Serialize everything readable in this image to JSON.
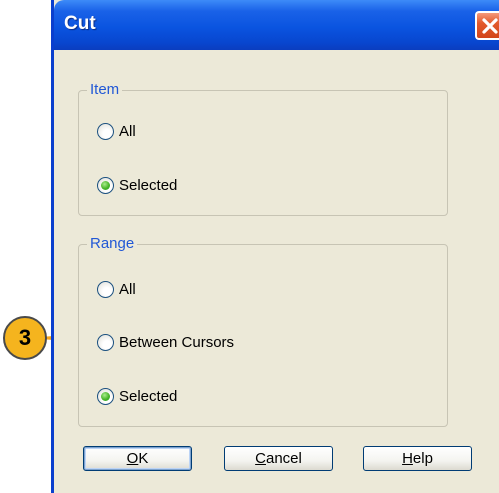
{
  "window": {
    "title": "Cut"
  },
  "item_group": {
    "legend": "Item",
    "options": [
      {
        "label": "All",
        "checked": false
      },
      {
        "label": "Selected",
        "checked": true
      }
    ]
  },
  "range_group": {
    "legend": "Range",
    "options": [
      {
        "label": "All",
        "checked": false
      },
      {
        "label": "Between Cursors",
        "checked": false
      },
      {
        "label": "Selected",
        "checked": true
      }
    ]
  },
  "buttons": {
    "ok": {
      "mnemonic": "O",
      "rest": "K"
    },
    "cancel": {
      "mnemonic": "C",
      "rest": "ancel"
    },
    "help": {
      "mnemonic": "H",
      "rest": "elp"
    }
  },
  "callout": {
    "number": "3",
    "color": "#f5b41e"
  },
  "colors": {
    "titlebar": "#0a54e0",
    "close_button": "#e35a2c",
    "legend_text": "#2158d6",
    "dialog_bg": "#ece9d8"
  }
}
